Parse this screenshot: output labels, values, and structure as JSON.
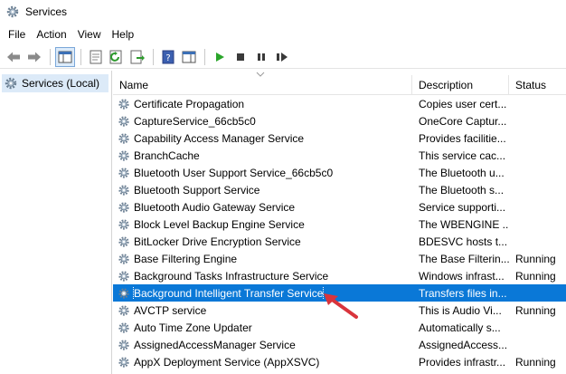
{
  "window": {
    "title": "Services"
  },
  "menu": [
    "File",
    "Action",
    "View",
    "Help"
  ],
  "left_pane": {
    "tree_item": "Services (Local)"
  },
  "columns": {
    "name": "Name",
    "description": "Description",
    "status": "Status"
  },
  "services": [
    {
      "name": "Certificate Propagation",
      "description": "Copies user cert...",
      "status": ""
    },
    {
      "name": "CaptureService_66cb5c0",
      "description": "OneCore Captur...",
      "status": ""
    },
    {
      "name": "Capability Access Manager Service",
      "description": "Provides facilitie...",
      "status": ""
    },
    {
      "name": "BranchCache",
      "description": "This service cac...",
      "status": ""
    },
    {
      "name": "Bluetooth User Support Service_66cb5c0",
      "description": "The Bluetooth u...",
      "status": ""
    },
    {
      "name": "Bluetooth Support Service",
      "description": "The Bluetooth s...",
      "status": ""
    },
    {
      "name": "Bluetooth Audio Gateway Service",
      "description": "Service supporti...",
      "status": ""
    },
    {
      "name": "Block Level Backup Engine Service",
      "description": "The WBENGINE ...",
      "status": ""
    },
    {
      "name": "BitLocker Drive Encryption Service",
      "description": "BDESVC hosts t...",
      "status": ""
    },
    {
      "name": "Base Filtering Engine",
      "description": "The Base Filterin...",
      "status": "Running"
    },
    {
      "name": "Background Tasks Infrastructure Service",
      "description": "Windows infrast...",
      "status": "Running"
    },
    {
      "name": "Background Intelligent Transfer Service",
      "description": "Transfers files in...",
      "status": "",
      "selected": true
    },
    {
      "name": "AVCTP service",
      "description": "This is Audio Vi...",
      "status": "Running"
    },
    {
      "name": "Auto Time Zone Updater",
      "description": "Automatically s...",
      "status": ""
    },
    {
      "name": "AssignedAccessManager Service",
      "description": "AssignedAccess...",
      "status": ""
    },
    {
      "name": "AppX Deployment Service (AppXSVC)",
      "description": "Provides infrastr...",
      "status": "Running"
    }
  ],
  "colors": {
    "selection": "#0a78d7",
    "annotation_arrow": "#d9343c",
    "play_green": "#2aa52a"
  }
}
